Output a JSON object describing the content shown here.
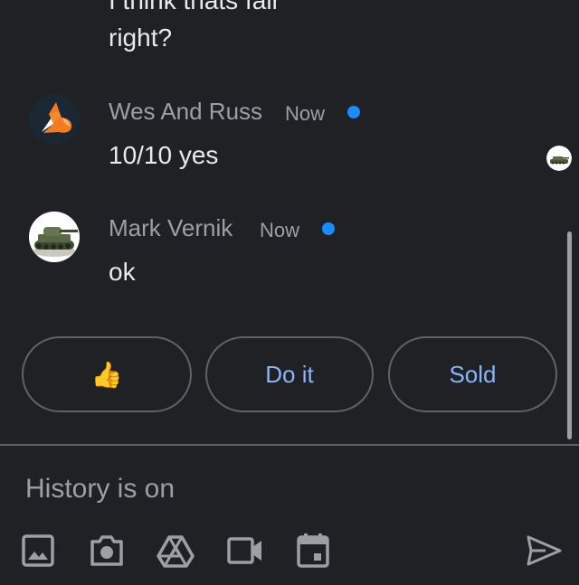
{
  "theme": {
    "background": "#202124",
    "text": "#e8eaed",
    "secondary_text": "#9aa0a6",
    "accent": "#8ab4f8",
    "unread_dot": "#1a8cff",
    "outline": "#5f6368"
  },
  "messages": [
    {
      "text_lines": [
        "I think thats fair",
        "right?"
      ]
    },
    {
      "sender": "Wes And Russ",
      "time": "Now",
      "avatar_icon": "fox-logo-icon",
      "text": "10/10 yes",
      "unread": true
    },
    {
      "sender": "Mark Vernik",
      "time": "Now",
      "avatar_icon": "tank-avatar-icon",
      "text": "ok",
      "unread": true
    }
  ],
  "read_receipt_icon": "tank-avatar-icon",
  "smart_replies": [
    {
      "label": "👍",
      "icon": "thumbs-up-emoji"
    },
    {
      "label": "Do it"
    },
    {
      "label": "Sold"
    }
  ],
  "compose": {
    "placeholder": "History is on"
  },
  "toolbar": [
    {
      "icon": "image-icon"
    },
    {
      "icon": "camera-icon"
    },
    {
      "icon": "drive-icon"
    },
    {
      "icon": "video-icon"
    },
    {
      "icon": "calendar-icon"
    },
    {
      "icon": "send-icon"
    }
  ]
}
